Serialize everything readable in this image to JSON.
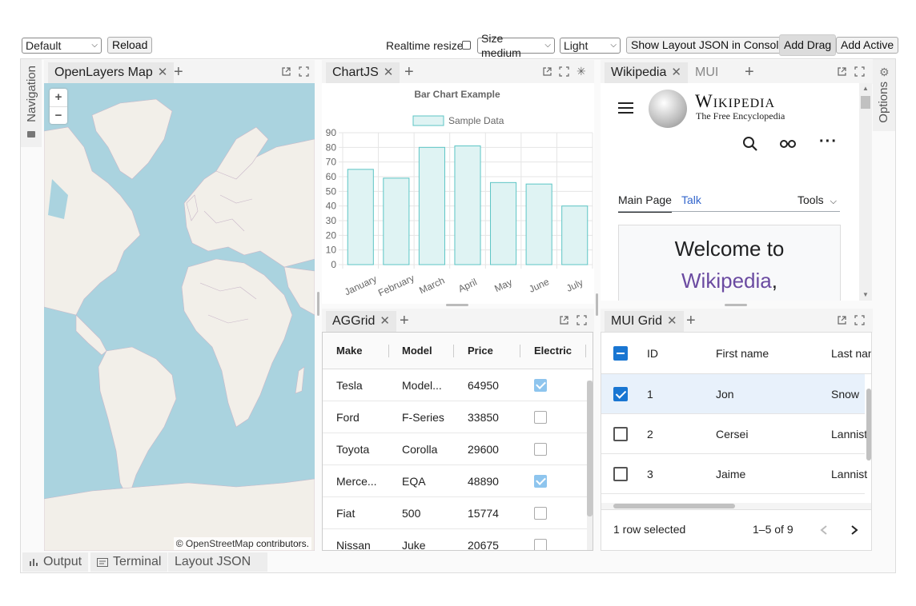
{
  "toolbar": {
    "layout_select": "Default",
    "reload": "Reload",
    "realtime_resize": "Realtime resize",
    "size_select": "Size medium",
    "theme_select": "Light",
    "show_json": "Show Layout JSON in Console",
    "add_drag": "Add Drag",
    "add_active": "Add Active"
  },
  "borders": {
    "left": "Navigation",
    "right": "Options",
    "bottom": [
      "Output",
      "Terminal",
      "Layout JSON"
    ]
  },
  "map": {
    "tab": "OpenLayers Map",
    "attribution_prefix": "© ",
    "attribution_link": "OpenStreetMap",
    "attribution_suffix": " contributors.",
    "zoom_in": "+",
    "zoom_out": "−"
  },
  "chartjs": {
    "tab": "ChartJS"
  },
  "chart_data": {
    "type": "bar",
    "title": "Bar Chart Example",
    "categories": [
      "January",
      "February",
      "March",
      "April",
      "May",
      "June",
      "July"
    ],
    "series": [
      {
        "name": "Sample Data",
        "values": [
          65,
          59,
          80,
          81,
          56,
          55,
          40
        ]
      }
    ],
    "ylim": [
      0,
      90
    ],
    "yticks": [
      0,
      10,
      20,
      30,
      40,
      50,
      60,
      70,
      80,
      90
    ],
    "grid": true,
    "legend": "top",
    "colors": {
      "fill": "#dff3f3",
      "stroke": "#5cc5c5"
    }
  },
  "wiki": {
    "tabs": [
      "Wikipedia",
      "MUI"
    ],
    "wordmark": "Wikipedia",
    "tagline": "The Free Encyclopedia",
    "nav": {
      "main": "Main Page",
      "talk": "Talk",
      "tools": "Tools"
    },
    "welcome": "Welcome to",
    "link": "Wikipedia",
    "comma": ","
  },
  "aggrid": {
    "tab": "AGGrid",
    "columns": [
      "Make",
      "Model",
      "Price",
      "Electric"
    ],
    "rows": [
      {
        "make": "Tesla",
        "model": "Model...",
        "price": "64950",
        "electric": true
      },
      {
        "make": "Ford",
        "model": "F-Series",
        "price": "33850",
        "electric": false
      },
      {
        "make": "Toyota",
        "model": "Corolla",
        "price": "29600",
        "electric": false
      },
      {
        "make": "Merce...",
        "model": "EQA",
        "price": "48890",
        "electric": true
      },
      {
        "make": "Fiat",
        "model": "500",
        "price": "15774",
        "electric": false
      },
      {
        "make": "Nissan",
        "model": "Juke",
        "price": "20675",
        "electric": false
      }
    ]
  },
  "muigrid": {
    "tab": "MUI Grid",
    "columns": [
      "ID",
      "First name",
      "Last nan"
    ],
    "rows": [
      {
        "id": "1",
        "first": "Jon",
        "last": "Snow",
        "checked": true
      },
      {
        "id": "2",
        "first": "Cersei",
        "last": "Lannist",
        "checked": false
      },
      {
        "id": "3",
        "first": "Jaime",
        "last": "Lannist",
        "checked": false
      }
    ],
    "footer_selected": "1 row selected",
    "footer_pages": "1–5 of 9"
  }
}
